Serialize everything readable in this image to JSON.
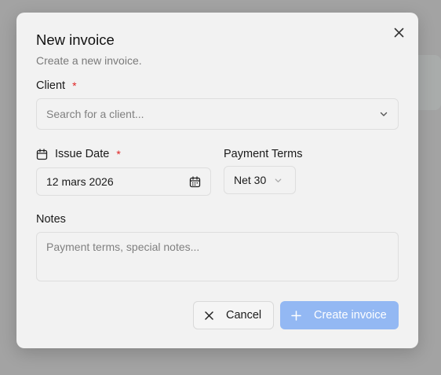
{
  "dialog": {
    "title": "New invoice",
    "subtitle": "Create a new invoice."
  },
  "client": {
    "label": "Client",
    "required_mark": "*",
    "placeholder": "Search for a client..."
  },
  "issue_date": {
    "label": "Issue Date",
    "required_mark": "*",
    "value": "12 mars 2026"
  },
  "payment_terms": {
    "label": "Payment Terms",
    "value": "Net 30"
  },
  "notes": {
    "label": "Notes",
    "placeholder": "Payment terms, special notes..."
  },
  "actions": {
    "cancel_label": "Cancel",
    "create_label": "Create invoice"
  },
  "colors": {
    "primary_disabled": "#93b8f3",
    "required": "#e02424",
    "background": "#f2f2f2"
  },
  "icons": {
    "close": "close-icon",
    "chevron": "chevron-down-icon",
    "calendar": "calendar-icon",
    "plus": "plus-icon"
  }
}
